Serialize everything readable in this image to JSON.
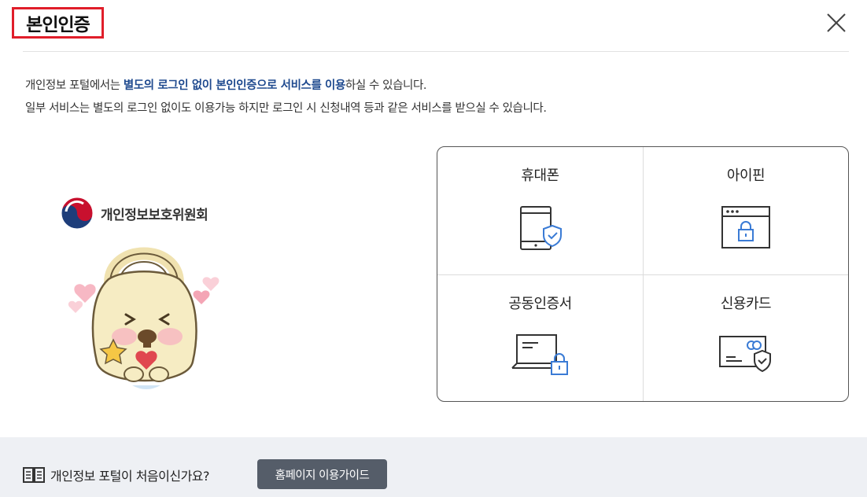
{
  "header": {
    "title": "본인인증",
    "close_label": "닫기"
  },
  "intro": {
    "line1_prefix": "개인정보 포털에서는 ",
    "line1_highlight": "별도의 로그인 없이 본인인증으로 서비스를 이용",
    "line1_suffix": "하실 수 있습니다.",
    "line2": "일부 서비스는 별도의 로그인 없이도 이용가능 하지만 로그인 시 신청내역 등과 같은 서비스를 받으실 수 있습니다."
  },
  "logo": {
    "text": "개인정보보호위원회"
  },
  "methods": [
    {
      "label": "휴대폰",
      "icon": "mobile-phone-shield-icon"
    },
    {
      "label": "아이핀",
      "icon": "browser-lock-icon"
    },
    {
      "label": "공동인증서",
      "icon": "laptop-lock-icon"
    },
    {
      "label": "신용카드",
      "icon": "credit-card-shield-icon"
    }
  ],
  "footer": {
    "question": "개인정보 포털이 처음이신가요?",
    "guide_button": "홈페이지 이용가이드"
  },
  "colors": {
    "title_border": "#e01e2a",
    "highlight": "#1f4a8f",
    "accent_blue": "#3a7bd5",
    "footer_bg": "#eef0f4",
    "button_bg": "#555d69"
  }
}
